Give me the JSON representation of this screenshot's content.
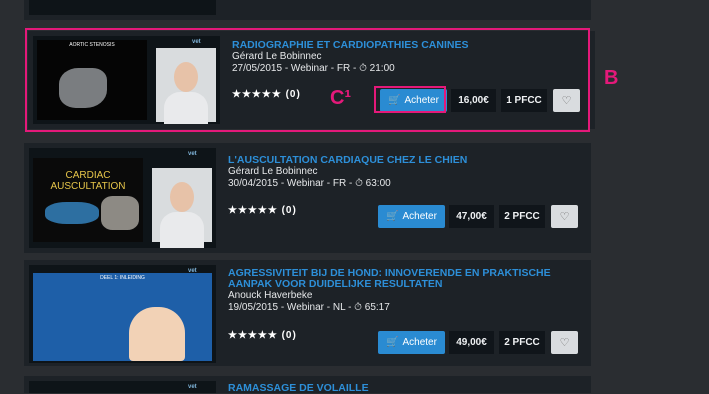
{
  "courses": [
    {
      "title": "RADIOGRAPHIE ET CARDIOPATHIES CANINES",
      "author": "Gérard Le Bobinnec",
      "meta": "27/05/2015 - Webinar - FR - ⏱ 21:00",
      "rating": "★★★★★ (0)",
      "buy": "Acheter",
      "price": "16,00€",
      "pfcc": "1 PFCC",
      "slide_title": "AORTIC STENOSIS"
    },
    {
      "title": "L'AUSCULTATION CARDIAQUE CHEZ LE CHIEN",
      "author": "Gérard Le Bobinnec",
      "meta": "30/04/2015 - Webinar - FR - ⏱ 63:00",
      "rating": "★★★★★ (0)",
      "buy": "Acheter",
      "price": "47,00€",
      "pfcc": "2 PFCC",
      "slide_title": "CARDIAC AUSCULTATION"
    },
    {
      "title": "AGRESSIVITEIT BIJ DE HOND: INNOVERENDE EN PRAKTISCHE AANPAK VOOR DUIDELIJKE RESULTATEN",
      "author": "Anouck Haverbeke",
      "meta": "19/05/2015 - Webinar - NL - ⏱ 65:17",
      "rating": "★★★★★ (0)",
      "buy": "Acheter",
      "price": "49,00€",
      "pfcc": "2 PFCC",
      "slide_title": "DEEL 1: INLEIDING"
    },
    {
      "title": "RAMASSAGE DE VOLAILLE"
    }
  ],
  "annotations": {
    "b": "B",
    "c": "C¹"
  },
  "logo_text": "vet",
  "colors": {
    "accent": "#2a8bd2",
    "highlight": "#e4197a",
    "card": "#1d2227",
    "background": "#2a2d31"
  }
}
